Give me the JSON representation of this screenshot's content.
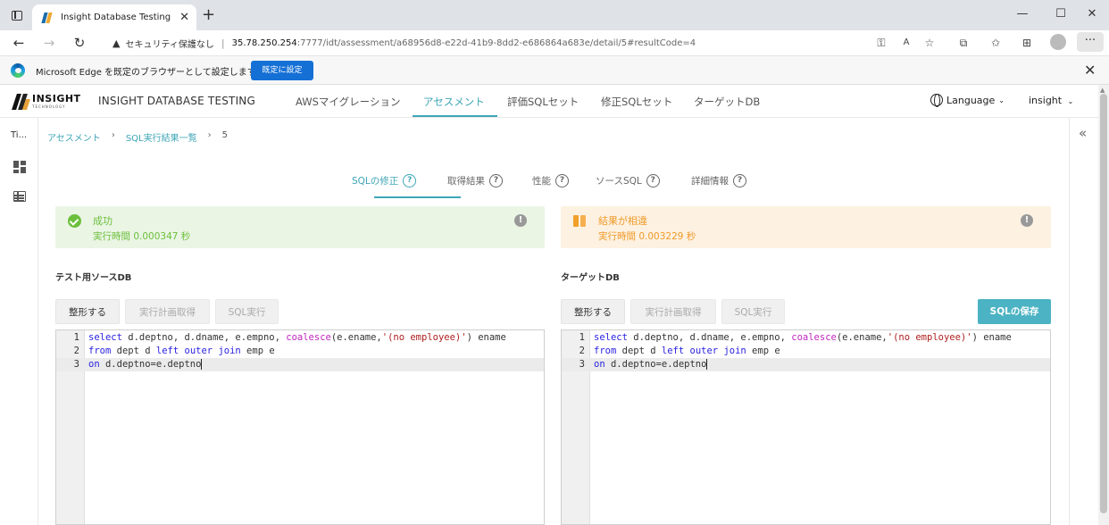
{
  "browser": {
    "tab_title": "Insight Database Testing",
    "tab_close": "✕",
    "new_tab": "+",
    "window_controls": {
      "minimize": "—",
      "maximize": "☐",
      "close": "✕"
    },
    "nav": {
      "back": "←",
      "forward": "→",
      "reload": "↻"
    },
    "security_warning": "セキュリティ保護なし",
    "url_host": "35.78.250.254",
    "url_path": ":7777/idt/assessment/a68956d8-e22d-41b9-8dd2-e686864a683e/detail/5#resultCode=4",
    "more": "···"
  },
  "infobar": {
    "message": "Microsoft Edge を既定のブラウザーとして設定しますか?",
    "button": "既定に設定",
    "close": "✕"
  },
  "app": {
    "logo_text": "INSIGHT",
    "logo_sub": "TECHNOLOGY",
    "title": "INSIGHT DATABASE TESTING",
    "menu": [
      "AWSマイグレーション",
      "アセスメント",
      "評価SQLセット",
      "修正SQLセット",
      "ターゲットDB"
    ],
    "active_menu": "アセスメント",
    "language": "Language",
    "user": "insight",
    "accent_color": "#3ea6b6"
  },
  "leftrail": {
    "label": "Ti..."
  },
  "breadcrumb": [
    "アセスメント",
    "SQL実行結果一覧",
    "5"
  ],
  "subtabs": [
    "SQLの修正",
    "取得結果",
    "性能",
    "ソースSQL",
    "詳細情報"
  ],
  "alerts": {
    "source": {
      "title": "成功",
      "time": "実行時間 0.000347 秒",
      "info": "!"
    },
    "target": {
      "title": "結果が相違",
      "time": "実行時間 0.003229 秒",
      "info": "!"
    }
  },
  "panels": {
    "source": {
      "label": "テスト用ソースDB",
      "buttons": [
        "整形する",
        "実行計画取得",
        "SQL実行"
      ]
    },
    "target": {
      "label": "ターゲットDB",
      "buttons": [
        "整形する",
        "実行計画取得",
        "SQL実行"
      ],
      "save": "SQLの保存"
    }
  },
  "code": {
    "line_numbers": [
      "1",
      "2",
      "3"
    ],
    "lines": [
      [
        {
          "t": "select",
          "c": "kw"
        },
        {
          "t": " d.deptno, d.dname, e.empno, "
        },
        {
          "t": "coalesce",
          "c": "fn"
        },
        {
          "t": "(e.ename,"
        },
        {
          "t": "'(no employee)'",
          "c": "str"
        },
        {
          "t": ") ename"
        }
      ],
      [
        {
          "t": "from",
          "c": "kw"
        },
        {
          "t": " dept d "
        },
        {
          "t": "left",
          "c": "kw"
        },
        {
          "t": " "
        },
        {
          "t": "outer",
          "c": "kw"
        },
        {
          "t": " "
        },
        {
          "t": "join",
          "c": "kw"
        },
        {
          "t": " emp e"
        }
      ],
      [
        {
          "t": "on",
          "c": "kw"
        },
        {
          "t": " d.deptno=e.deptno"
        }
      ]
    ]
  }
}
